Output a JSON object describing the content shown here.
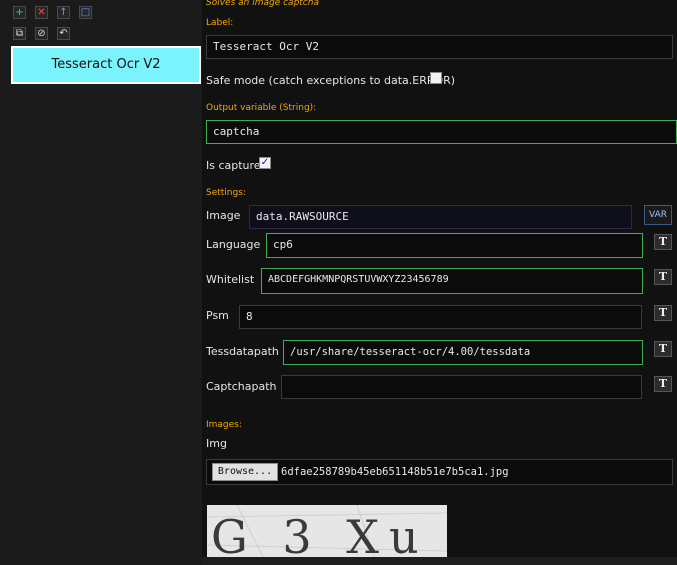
{
  "toolbar": {
    "add_icon": "plus-icon",
    "remove_icon": "x-icon",
    "up_icon": "arrow-up-icon",
    "square_icon": "square-icon",
    "clone_icon": "copy-icon",
    "disable_icon": "disable-icon",
    "undo_icon": "undo-icon",
    "colors": {
      "add": "#3fd16a",
      "remove": "#ff4b4b",
      "up": "#5aa0ff",
      "square": "#5aa0ff"
    }
  },
  "block": {
    "label": "Tesseract Ocr V2",
    "color": "#7af3fc"
  },
  "header": {
    "description": "Solves an image captcha"
  },
  "form": {
    "label_heading": "Label:",
    "label_value": "Tesseract Ocr V2",
    "safe_mode_label": "Safe mode (catch exceptions to data.ERROR)",
    "safe_mode_checked": false,
    "output_heading": "Output variable (String):",
    "output_value": "captcha",
    "is_capture_label": "Is capture",
    "is_capture_checked": true,
    "settings_heading": "Settings:"
  },
  "settings": {
    "image": {
      "label": "Image",
      "value": "data.RAWSOURCE",
      "var_button": "VAR"
    },
    "language": {
      "label": "Language",
      "value": "cp6",
      "t_button": "T"
    },
    "whitelist": {
      "label": "Whitelist",
      "value": "ABCDEFGHKMNPQRSTUVWXYZ23456789",
      "t_button": "T"
    },
    "psm": {
      "label": "Psm",
      "value": "8",
      "t_button": "T"
    },
    "tessdatapath": {
      "label": "Tessdatapath",
      "value": "/usr/share/tesseract-ocr/4.00/tessdata",
      "t_button": "T"
    },
    "captchapath": {
      "label": "Captchapath",
      "value": "",
      "t_button": "T"
    }
  },
  "images": {
    "heading": "Images:",
    "img_label": "Img",
    "browse_label": "Browse...",
    "filename": "6dfae258789b45eb651148b51e7b5ca1.jpg",
    "captcha_text": "G 3 Xu"
  }
}
